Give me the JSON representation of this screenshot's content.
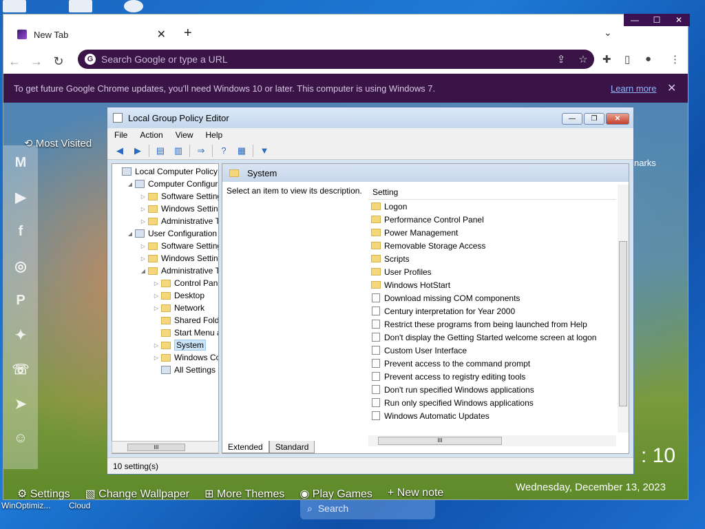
{
  "desktop": {
    "labels": [
      "WinOptimiz...",
      "Cloud"
    ],
    "search": "Search"
  },
  "chrome": {
    "tab_title": "New Tab",
    "omnibox_placeholder": "Search Google or type a URL",
    "infobar_text": "To get future Google Chrome updates, you'll need Windows 10 or later. This computer is using Windows 7.",
    "infobar_link": "Learn more",
    "accent": "#3a1447"
  },
  "ntp": {
    "most_visited": "Most Visited",
    "bookmarks": "narks",
    "social_icons": [
      "gmail-icon",
      "youtube-icon",
      "facebook-icon",
      "instagram-icon",
      "pinterest-icon",
      "twitter-icon",
      "whatsapp-icon",
      "telegram-icon",
      "reddit-icon"
    ],
    "bottom": [
      "Settings",
      "Change Wallpaper",
      "More Themes",
      "Play Games",
      "+ New note"
    ],
    "clock": ": 10",
    "date": "Wednesday, December 13, 2023"
  },
  "gpe": {
    "title": "Local Group Policy Editor",
    "menu": [
      "File",
      "Action",
      "View",
      "Help"
    ],
    "tree": [
      {
        "label": "Local Computer Policy",
        "depth": 0,
        "arrow": "",
        "icon": "pc"
      },
      {
        "label": "Computer Configura",
        "depth": 1,
        "arrow": "◢",
        "icon": "pc"
      },
      {
        "label": "Software Settings",
        "depth": 2,
        "arrow": "▷",
        "icon": "folder"
      },
      {
        "label": "Windows Setting",
        "depth": 2,
        "arrow": "▷",
        "icon": "folder"
      },
      {
        "label": "Administrative Te",
        "depth": 2,
        "arrow": "▷",
        "icon": "folder"
      },
      {
        "label": "User Configuration",
        "depth": 1,
        "arrow": "◢",
        "icon": "pc"
      },
      {
        "label": "Software Settings",
        "depth": 2,
        "arrow": "▷",
        "icon": "folder"
      },
      {
        "label": "Windows Setting",
        "depth": 2,
        "arrow": "▷",
        "icon": "folder"
      },
      {
        "label": "Administrative Te",
        "depth": 2,
        "arrow": "◢",
        "icon": "folder"
      },
      {
        "label": "Control Panel",
        "depth": 3,
        "arrow": "▷",
        "icon": "folder"
      },
      {
        "label": "Desktop",
        "depth": 3,
        "arrow": "▷",
        "icon": "folder"
      },
      {
        "label": "Network",
        "depth": 3,
        "arrow": "▷",
        "icon": "folder"
      },
      {
        "label": "Shared Folder",
        "depth": 3,
        "arrow": "",
        "icon": "folder"
      },
      {
        "label": "Start Menu ar",
        "depth": 3,
        "arrow": "",
        "icon": "folder"
      },
      {
        "label": "System",
        "depth": 3,
        "arrow": "▷",
        "icon": "folder",
        "selected": true
      },
      {
        "label": "Windows Cor",
        "depth": 3,
        "arrow": "▷",
        "icon": "folder"
      },
      {
        "label": "All Settings",
        "depth": 3,
        "arrow": "",
        "icon": "settings"
      }
    ],
    "pane_header": "System",
    "description": "Select an item to view its description.",
    "column_header": "Setting",
    "settings": [
      {
        "label": "Logon",
        "type": "folder"
      },
      {
        "label": "Performance Control Panel",
        "type": "folder"
      },
      {
        "label": "Power Management",
        "type": "folder"
      },
      {
        "label": "Removable Storage Access",
        "type": "folder"
      },
      {
        "label": "Scripts",
        "type": "folder"
      },
      {
        "label": "User Profiles",
        "type": "folder"
      },
      {
        "label": "Windows HotStart",
        "type": "folder"
      },
      {
        "label": "Download missing COM components",
        "type": "policy"
      },
      {
        "label": "Century interpretation for Year 2000",
        "type": "policy"
      },
      {
        "label": "Restrict these programs from being launched from Help",
        "type": "policy"
      },
      {
        "label": "Don't display the Getting Started welcome screen at logon",
        "type": "policy"
      },
      {
        "label": "Custom User Interface",
        "type": "policy"
      },
      {
        "label": "Prevent access to the command prompt",
        "type": "policy"
      },
      {
        "label": "Prevent access to registry editing tools",
        "type": "policy"
      },
      {
        "label": "Don't run specified Windows applications",
        "type": "policy"
      },
      {
        "label": "Run only specified Windows applications",
        "type": "policy"
      },
      {
        "label": "Windows Automatic Updates",
        "type": "policy"
      }
    ],
    "tabs": [
      "Extended",
      "Standard"
    ],
    "status": "10 setting(s)"
  }
}
